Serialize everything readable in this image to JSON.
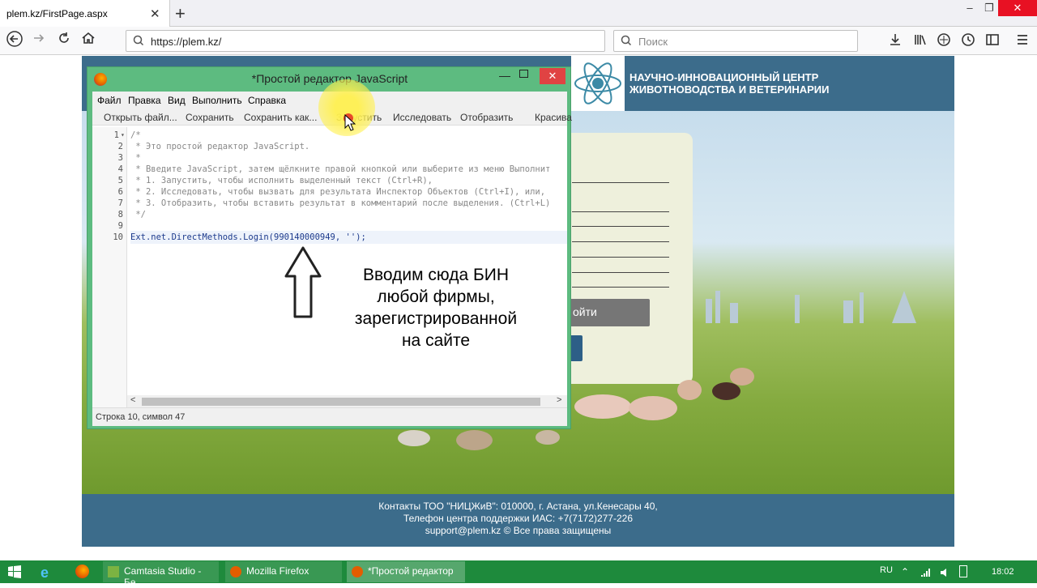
{
  "browser": {
    "tab_title": "plem.kz/FirstPage.aspx",
    "tab_close": "✕",
    "new_tab": "+",
    "url": "https://plem.kz/",
    "search_placeholder": "Поиск",
    "window_controls": [
      "–",
      "❐",
      "✕"
    ],
    "nav_icons": [
      "back-icon",
      "forward-icon",
      "reload-icon",
      "home-icon",
      "search-icon",
      "download-icon",
      "library-icon",
      "protection-icon",
      "history-icon",
      "sidebar-icon",
      "menu-icon"
    ]
  },
  "site": {
    "header_line1": "НАУЧНО-ИННОВАЦИОННЫЙ ЦЕНТР",
    "header_line2": "ЖИВОТНОВОДСТВА И ВЕТЕРИНАРИИ",
    "login_button": "ойти",
    "footer_line1": "Контакты ТОО \"НИЦЖиВ\": 010000, г. Астана, ул.Кенесары 40,",
    "footer_line2": "Телефон центра поддержки ИАС: +7(7172)277-226",
    "footer_line3": "support@plem.kz © Все права защищены"
  },
  "editor": {
    "title": "*Простой редактор JavaScript",
    "menu": [
      "Файл",
      "Правка",
      "Вид",
      "Выполнить",
      "Справка"
    ],
    "toolbar": [
      "Открыть файл...",
      "Сохранить",
      "Сохранить как...",
      "Запустить",
      "Исследовать",
      "Отобразить",
      "Красива"
    ],
    "line_numbers": [
      "1",
      "2",
      "3",
      "4",
      "5",
      "6",
      "7",
      "8",
      "9",
      "10"
    ],
    "code_lines": [
      "/*",
      " * Это простой редактор JavaScript.",
      " *",
      " * Введите JavaScript, затем щёлкните правой кнопкой или выберите из меню Выполнит",
      " * 1. Запустить, чтобы исполнить выделенный текст (Ctrl+R),",
      " * 2. Исследовать, чтобы вызвать для результата Инспектор Объектов (Ctrl+I), или,",
      " * 3. Отобразить, чтобы вставить результат в комментарий после выделения. (Ctrl+L)",
      " */",
      "",
      "Ext.net.DirectMethods.Login(990140000949, '');"
    ],
    "status": "Строка 10, символ 47",
    "scroll_left": "<",
    "scroll_right": ">"
  },
  "annotation": {
    "lines": [
      "Вводим сюда БИН",
      "любой фирмы,",
      "зарегистрированной",
      "на сайте"
    ]
  },
  "taskbar": {
    "items": [
      "Camtasia Studio - Бе...",
      "Mozilla Firefox",
      "*Простой редактор ..."
    ],
    "lang": "RU",
    "time": "18:02"
  }
}
